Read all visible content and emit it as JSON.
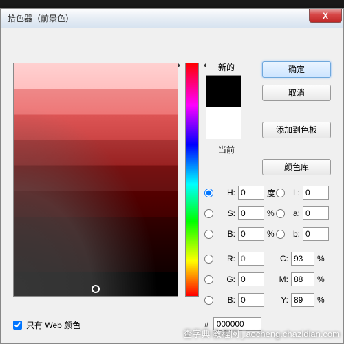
{
  "window": {
    "title": "拾色器（前景色）",
    "close_icon": "X"
  },
  "labels": {
    "new": "新的",
    "current": "当前"
  },
  "buttons": {
    "ok": "确定",
    "cancel": "取消",
    "add_swatch": "添加到色板",
    "color_lib": "颜色库"
  },
  "hsb": {
    "h": {
      "label": "H:",
      "value": "0",
      "unit": "度"
    },
    "s": {
      "label": "S:",
      "value": "0",
      "unit": "%"
    },
    "b": {
      "label": "B:",
      "value": "0",
      "unit": "%"
    }
  },
  "rgb": {
    "r": {
      "label": "R:",
      "value": "0"
    },
    "g": {
      "label": "G:",
      "value": "0"
    },
    "b": {
      "label": "B:",
      "value": "0"
    }
  },
  "lab": {
    "l": {
      "label": "L:",
      "value": "0"
    },
    "a": {
      "label": "a:",
      "value": "0"
    },
    "b": {
      "label": "b:",
      "value": "0"
    }
  },
  "cmyk": {
    "c": {
      "label": "C:",
      "value": "93",
      "unit": "%"
    },
    "m": {
      "label": "M:",
      "value": "88",
      "unit": "%"
    },
    "y": {
      "label": "Y:",
      "value": "89",
      "unit": "%"
    }
  },
  "hex": {
    "label": "#",
    "value": "000000"
  },
  "web_only": {
    "label": "只有 Web 颜色",
    "checked": true
  },
  "swatch": {
    "new_color": "#000000",
    "current_color": "#ffffff"
  },
  "watermark": "查字典 教程网 jiaocheng.chazidian.com"
}
